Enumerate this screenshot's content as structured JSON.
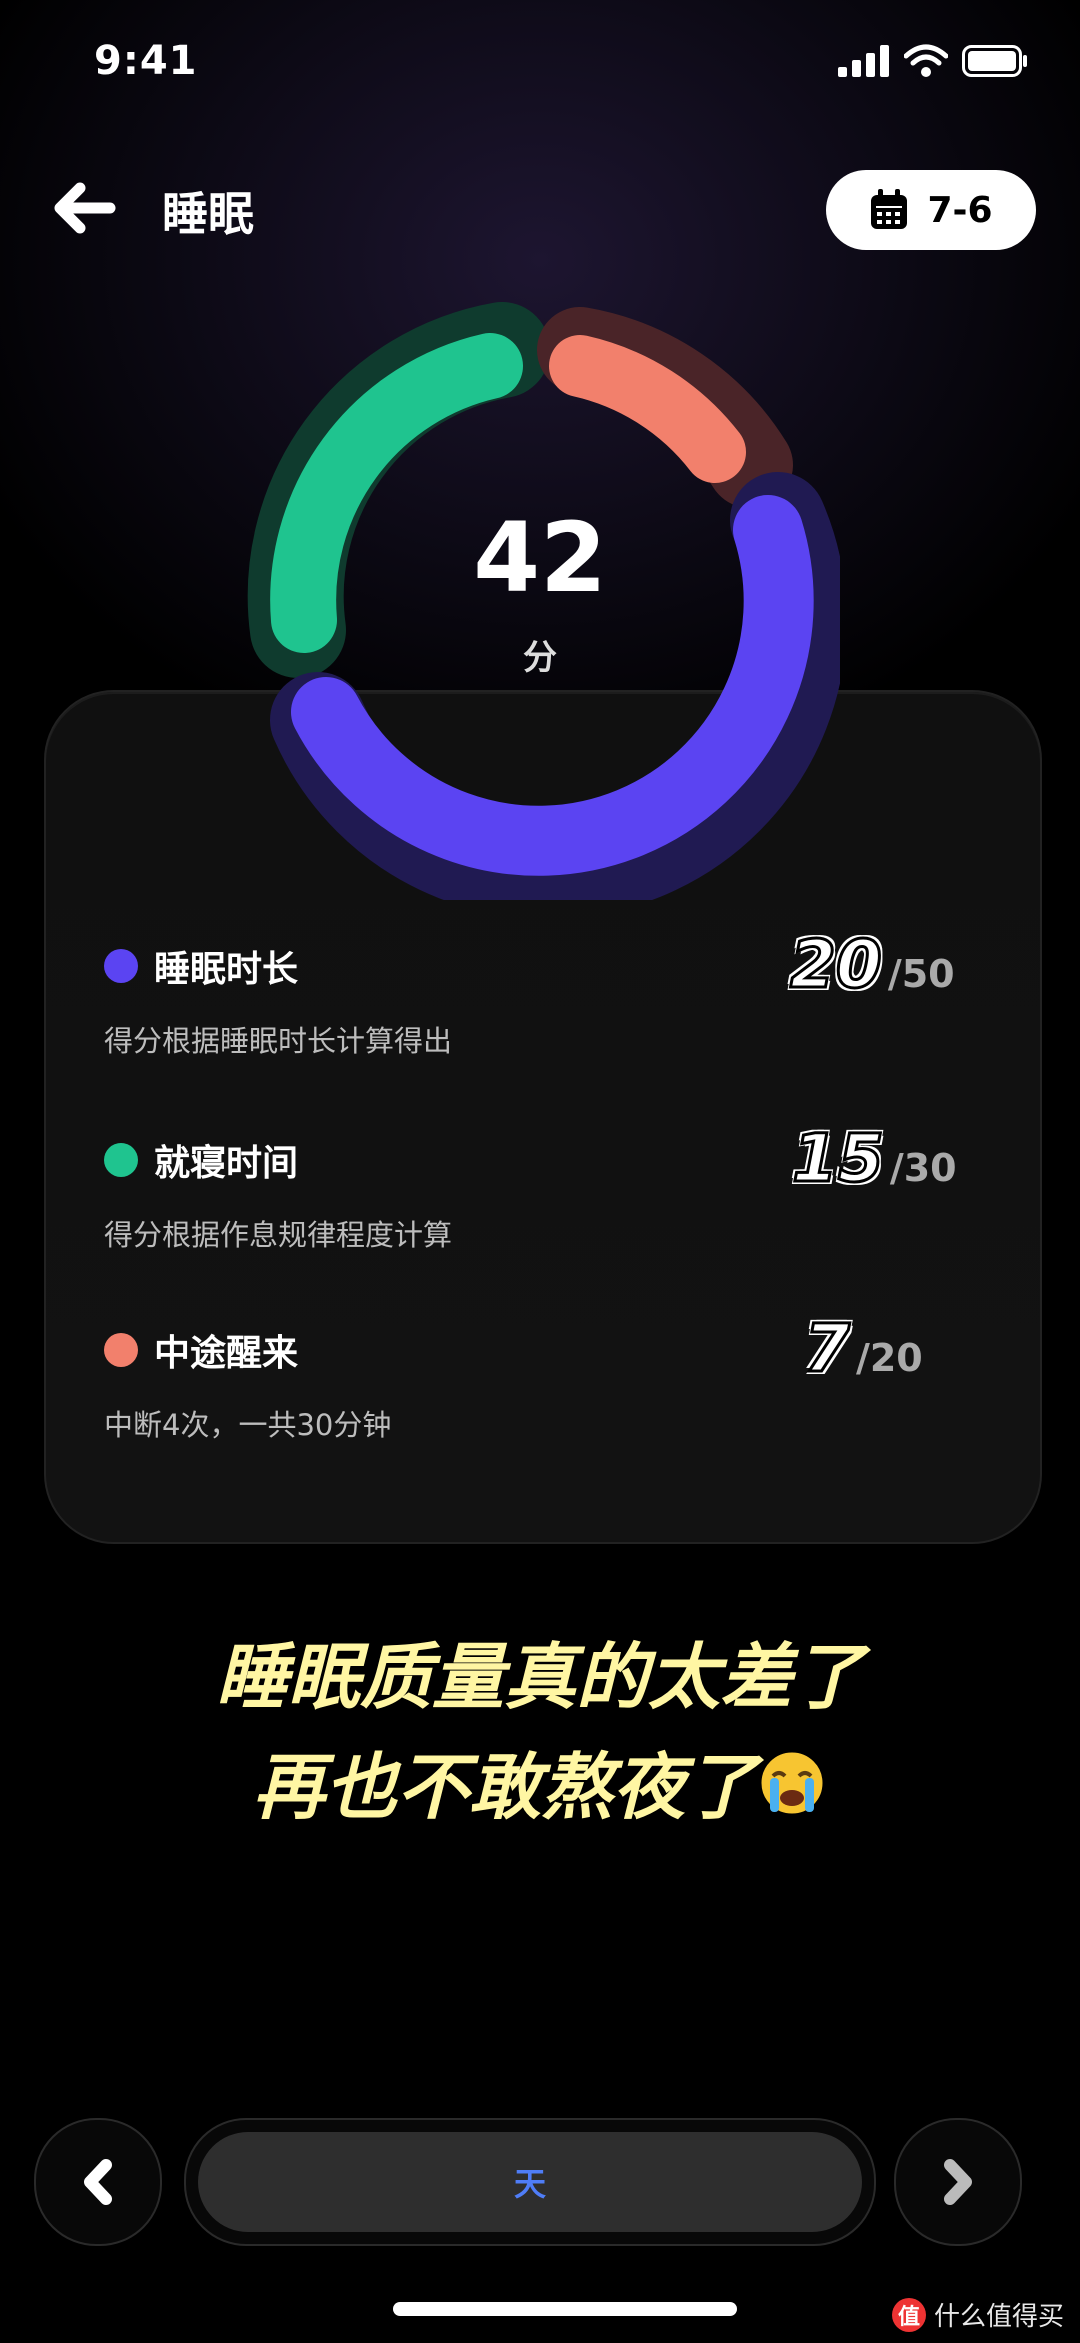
{
  "status": {
    "time": "9:41"
  },
  "header": {
    "title": "睡眠",
    "date": "7-6"
  },
  "score": {
    "value": "42",
    "unit": "分"
  },
  "rows": [
    {
      "title": "睡眠时长",
      "desc": "得分根据睡眠时长计算得出",
      "score": "20",
      "max": "/50",
      "color": "#5b44f2"
    },
    {
      "title": "就寝时间",
      "desc": "得分根据作息规律程度计算",
      "score": "15",
      "max": "/30",
      "color": "#1fc48f"
    },
    {
      "title": "中途醒来",
      "desc": "中断4次，一共30分钟",
      "score": "7",
      "max": "/20",
      "color": "#f2806c"
    }
  ],
  "caption": {
    "line1": "睡眠质量真的太差了",
    "line2": "再也不敢熬夜了"
  },
  "nav": {
    "period": "天"
  },
  "watermark": {
    "badge": "值",
    "text": "什么值得买"
  },
  "icons": [
    "back-arrow-icon",
    "calendar-icon",
    "signal-icon",
    "wifi-icon",
    "battery-icon",
    "crying-face-emoji",
    "chevron-left-icon",
    "chevron-right-icon"
  ]
}
